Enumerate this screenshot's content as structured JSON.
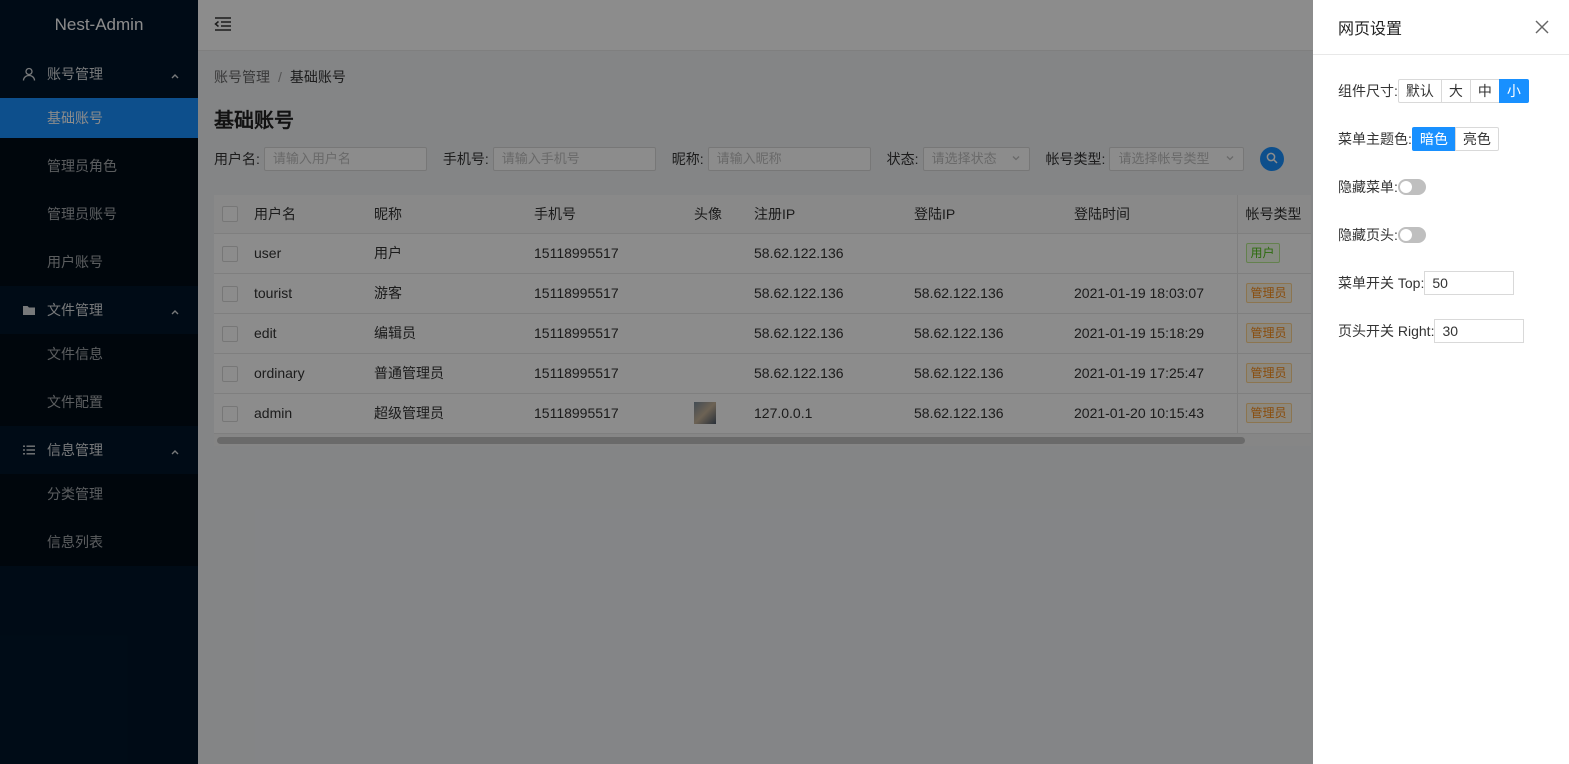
{
  "app": {
    "logo": "Nest-Admin"
  },
  "sidebar": {
    "groups": [
      {
        "title": "账号管理",
        "icon": "user-icon",
        "items": [
          {
            "label": "基础账号",
            "active": true
          },
          {
            "label": "管理员角色"
          },
          {
            "label": "管理员账号"
          },
          {
            "label": "用户账号"
          }
        ]
      },
      {
        "title": "文件管理",
        "icon": "folder-icon",
        "items": [
          {
            "label": "文件信息"
          },
          {
            "label": "文件配置"
          }
        ]
      },
      {
        "title": "信息管理",
        "icon": "list-icon",
        "items": [
          {
            "label": "分类管理"
          },
          {
            "label": "信息列表"
          }
        ]
      }
    ]
  },
  "breadcrumb": {
    "parent": "账号管理",
    "sep": "/",
    "current": "基础账号"
  },
  "page": {
    "title": "基础账号"
  },
  "filters": {
    "username": {
      "label": "用户名:",
      "placeholder": "请输入用户名"
    },
    "phone": {
      "label": "手机号:",
      "placeholder": "请输入手机号"
    },
    "nickname": {
      "label": "昵称:",
      "placeholder": "请输入昵称"
    },
    "status": {
      "label": "状态:",
      "placeholder": "请选择状态"
    },
    "type": {
      "label": "帐号类型:",
      "placeholder": "请选择帐号类型"
    }
  },
  "table": {
    "headers": [
      "用户名",
      "昵称",
      "手机号",
      "头像",
      "注册IP",
      "登陆IP",
      "登陆时间",
      "帐号类型"
    ],
    "rows": [
      {
        "username": "user",
        "nickname": "用户",
        "phone": "15118995517",
        "avatar": false,
        "reg_ip": "58.62.122.136",
        "login_ip": "",
        "login_time": "",
        "type": "用户",
        "type_kind": "user"
      },
      {
        "username": "tourist",
        "nickname": "游客",
        "phone": "15118995517",
        "avatar": false,
        "reg_ip": "58.62.122.136",
        "login_ip": "58.62.122.136",
        "login_time": "2021-01-19 18:03:07",
        "type": "管理员",
        "type_kind": "admin"
      },
      {
        "username": "edit",
        "nickname": "编辑员",
        "phone": "15118995517",
        "avatar": false,
        "reg_ip": "58.62.122.136",
        "login_ip": "58.62.122.136",
        "login_time": "2021-01-19 15:18:29",
        "type": "管理员",
        "type_kind": "admin"
      },
      {
        "username": "ordinary",
        "nickname": "普通管理员",
        "phone": "15118995517",
        "avatar": false,
        "reg_ip": "58.62.122.136",
        "login_ip": "58.62.122.136",
        "login_time": "2021-01-19 17:25:47",
        "type": "管理员",
        "type_kind": "admin"
      },
      {
        "username": "admin",
        "nickname": "超级管理员",
        "phone": "15118995517",
        "avatar": true,
        "reg_ip": "127.0.0.1",
        "login_ip": "58.62.122.136",
        "login_time": "2021-01-20 10:15:43",
        "type": "管理员",
        "type_kind": "admin"
      }
    ]
  },
  "drawer": {
    "title": "网页设置",
    "size_label": "组件尺寸:",
    "size_options": [
      "默认",
      "大",
      "中",
      "小"
    ],
    "size_selected": "小",
    "theme_label": "菜单主题色:",
    "theme_options": [
      "暗色",
      "亮色"
    ],
    "theme_selected": "暗色",
    "hide_menu_label": "隐藏菜单:",
    "hide_menu": false,
    "hide_header_label": "隐藏页头:",
    "hide_header": false,
    "menu_top_label": "菜单开关 Top:",
    "menu_top_value": "50",
    "header_right_label": "页头开关 Right:",
    "header_right_value": "30"
  },
  "colors": {
    "primary": "#1890ff",
    "sidebar": "#001529",
    "submenu": "#000c17"
  }
}
